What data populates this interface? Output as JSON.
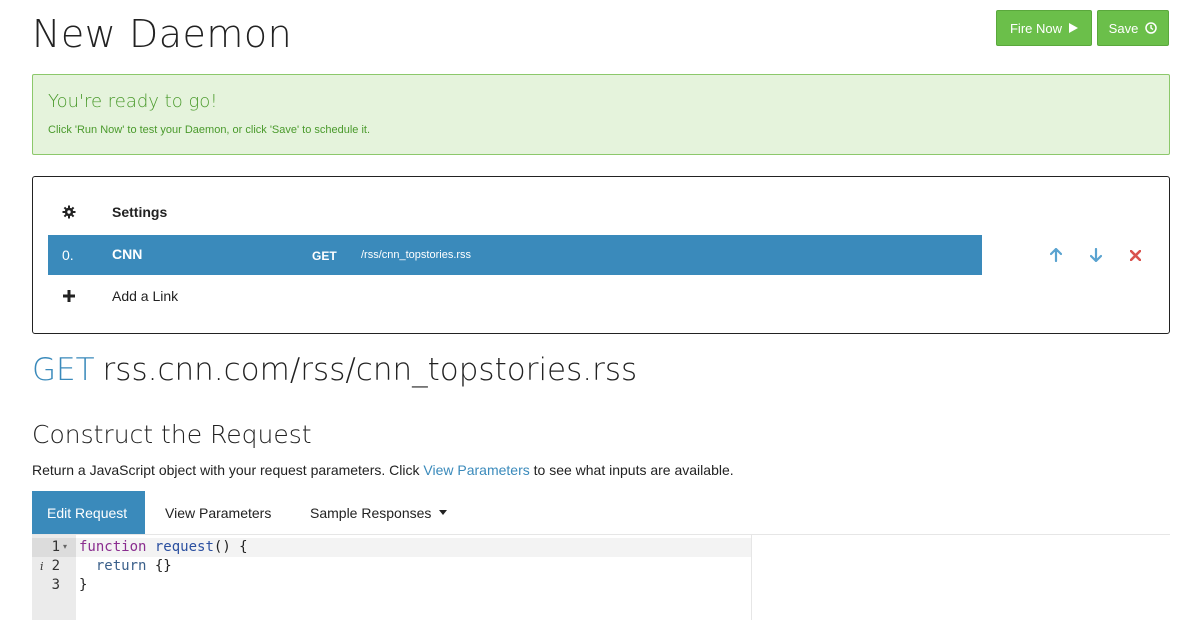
{
  "header": {
    "title": "New Daemon",
    "fire_label": "Fire Now",
    "save_label": "Save"
  },
  "alert": {
    "title": "You're ready to go!",
    "message": "Click 'Run Now' to test your Daemon, or click 'Save' to schedule it."
  },
  "links": {
    "settings_label": "Settings",
    "items": [
      {
        "index": "0.",
        "name": "CNN",
        "method": "GET",
        "path": "/rss/cnn_topstories.rss"
      }
    ],
    "add_label": "Add a Link"
  },
  "request": {
    "method": "GET",
    "url": "rss.cnn.com/rss/cnn_topstories.rss"
  },
  "construct": {
    "title": "Construct the Request",
    "desc_before": "Return a JavaScript object with your request parameters. Click ",
    "desc_link": "View Parameters",
    "desc_after": " to see what inputs are available."
  },
  "tabs": [
    {
      "label": "Edit Request",
      "active": true
    },
    {
      "label": "View Parameters",
      "active": false
    },
    {
      "label": "Sample Responses",
      "active": false
    }
  ],
  "editor": {
    "line_numbers": [
      "1",
      "2",
      "3"
    ],
    "lines": [
      {
        "kw": "function",
        "fn": "request",
        "rest": "() {"
      },
      {
        "kw": "return",
        "rest": " {}"
      },
      {
        "text": "}"
      }
    ]
  },
  "colors": {
    "success": "#6bbf4a",
    "primary": "#3a8abb",
    "danger": "#d9534f"
  },
  "icons": [
    "play-icon",
    "clock-icon",
    "gear-icon",
    "plus-icon",
    "arrow-up-icon",
    "arrow-down-icon",
    "close-icon",
    "caret-down-icon"
  ]
}
